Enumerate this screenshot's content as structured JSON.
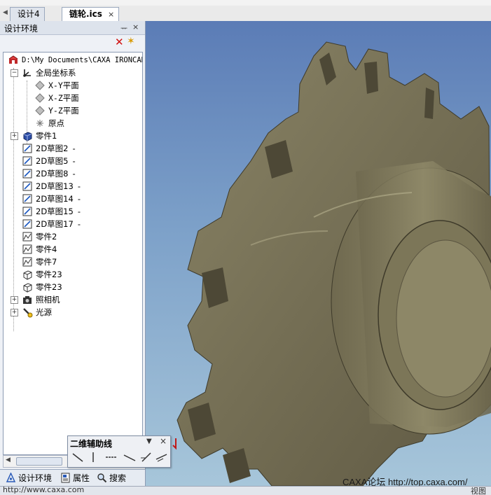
{
  "tabs": {
    "items": [
      {
        "label": "设计4",
        "active": false
      },
      {
        "label": "链轮.ics",
        "active": true
      }
    ],
    "close_glyph": "×"
  },
  "panel": {
    "title": "设计环境",
    "pin_glyph": "ᅲ",
    "close_glyph": "×"
  },
  "tree": {
    "root": "D:\\My Documents\\CAXA IRONCAD",
    "items": [
      {
        "label": "全局坐标系",
        "icon": "coordinate-system-icon"
      },
      {
        "label": "X-Y平面",
        "icon": "plane-icon"
      },
      {
        "label": "X-Z平面",
        "icon": "plane-icon"
      },
      {
        "label": "Y-Z平面",
        "icon": "plane-icon"
      },
      {
        "label": "原点",
        "icon": "origin-icon"
      },
      {
        "label": "零件1",
        "icon": "part-icon"
      },
      {
        "label": "2D草图2",
        "icon": "sketch-icon"
      },
      {
        "label": "2D草图5",
        "icon": "sketch-icon"
      },
      {
        "label": "2D草图8",
        "icon": "sketch-icon"
      },
      {
        "label": "2D草图13",
        "icon": "sketch-icon"
      },
      {
        "label": "2D草图14",
        "icon": "sketch-icon"
      },
      {
        "label": "2D草图15",
        "icon": "sketch-icon"
      },
      {
        "label": "2D草图17",
        "icon": "sketch-icon"
      },
      {
        "label": "零件2",
        "icon": "part-sheet-icon"
      },
      {
        "label": "零件4",
        "icon": "part-sheet-icon"
      },
      {
        "label": "零件7",
        "icon": "part-sheet-icon"
      },
      {
        "label": "零件23",
        "icon": "part-outline-icon"
      },
      {
        "label": "零件23",
        "icon": "part-outline-icon"
      },
      {
        "label": "照相机",
        "icon": "camera-icon"
      },
      {
        "label": "光源",
        "icon": "light-icon"
      }
    ],
    "dash": "-"
  },
  "bottom_tabs": [
    {
      "label": "设计环境",
      "icon": "design-env-icon"
    },
    {
      "label": "属性",
      "icon": "properties-icon"
    },
    {
      "label": "搜索",
      "icon": "search-icon"
    }
  ],
  "float_toolbar": {
    "title": "二维辅助线",
    "dropdown_glyph": "▼",
    "close_glyph": "×"
  },
  "watermark": "CAXA论坛 http://top.caxa.com/",
  "status": {
    "left": "http://www.caxa.com",
    "right": "视图"
  },
  "colors": {
    "viewport_top": "#5b7cb6",
    "viewport_bottom": "#a7c6da",
    "part": "#7a7356"
  }
}
